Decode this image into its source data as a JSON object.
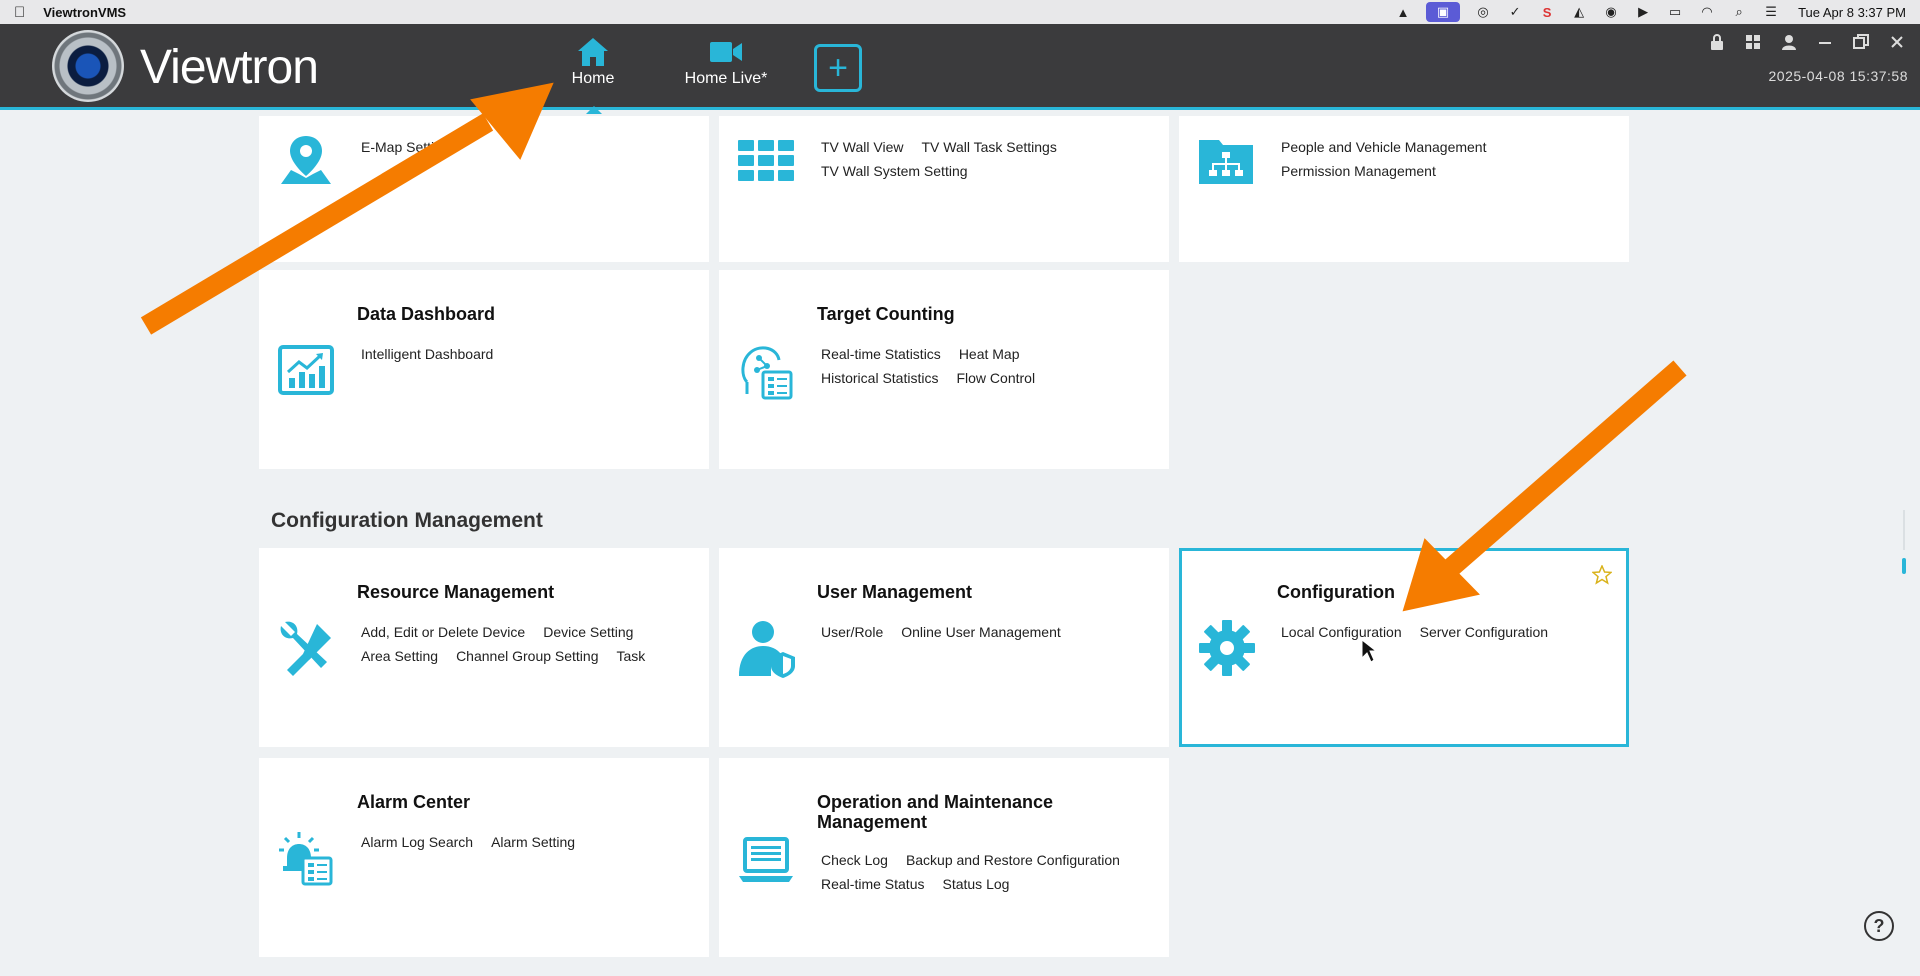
{
  "menubar": {
    "app_name": "ViewtronVMS",
    "clock": "Tue Apr 8  3:37 PM"
  },
  "header": {
    "brand": "Viewtron",
    "nav": [
      {
        "label": "Home",
        "icon": "home-icon",
        "active": true
      },
      {
        "label": "Home Live*",
        "icon": "video-camera-icon",
        "active": false
      }
    ],
    "add_label": "+",
    "datetime": "2025-04-08 15:37:58"
  },
  "cards_top": [
    {
      "title": "",
      "icon": "map-pin-icon",
      "links": [
        "E-Map Setting"
      ]
    },
    {
      "title": "",
      "icon": "tv-wall-icon",
      "links": [
        "TV Wall View",
        "TV Wall Task Settings",
        "TV Wall System Setting"
      ]
    },
    {
      "title": "",
      "icon": "org-folder-icon",
      "links": [
        "People and Vehicle Management",
        "Permission Management"
      ]
    }
  ],
  "cards_mid": [
    {
      "title": "Data Dashboard",
      "icon": "chart-icon",
      "links": [
        "Intelligent Dashboard"
      ]
    },
    {
      "title": "Target Counting",
      "icon": "head-analytics-icon",
      "links": [
        "Real-time Statistics",
        "Heat Map",
        "Historical Statistics",
        "Flow Control"
      ]
    }
  ],
  "section": {
    "title": "Configuration Management"
  },
  "cards_config": [
    {
      "title": "Resource Management",
      "icon": "tools-icon",
      "links": [
        "Add, Edit or Delete Device",
        "Device Setting",
        "Area Setting",
        "Channel Group Setting",
        "Task"
      ]
    },
    {
      "title": "User Management",
      "icon": "user-shield-icon",
      "links": [
        "User/Role",
        "Online User Management"
      ]
    },
    {
      "title": "Configuration",
      "icon": "gear-icon",
      "links": [
        "Local Configuration",
        "Server Configuration"
      ]
    }
  ],
  "cards_bottom": [
    {
      "title": "Alarm Center",
      "icon": "alarm-icon",
      "links": [
        "Alarm Log Search",
        "Alarm Setting"
      ]
    },
    {
      "title": "Operation and Maintenance Management",
      "icon": "laptop-log-icon",
      "links": [
        "Check Log",
        "Backup and Restore Configuration",
        "Real-time Status",
        "Status Log"
      ]
    }
  ],
  "help_label": "?",
  "colors": {
    "accent": "#29b6d8",
    "header_bg": "#3b3b3d",
    "annotation": "#f57c00"
  }
}
